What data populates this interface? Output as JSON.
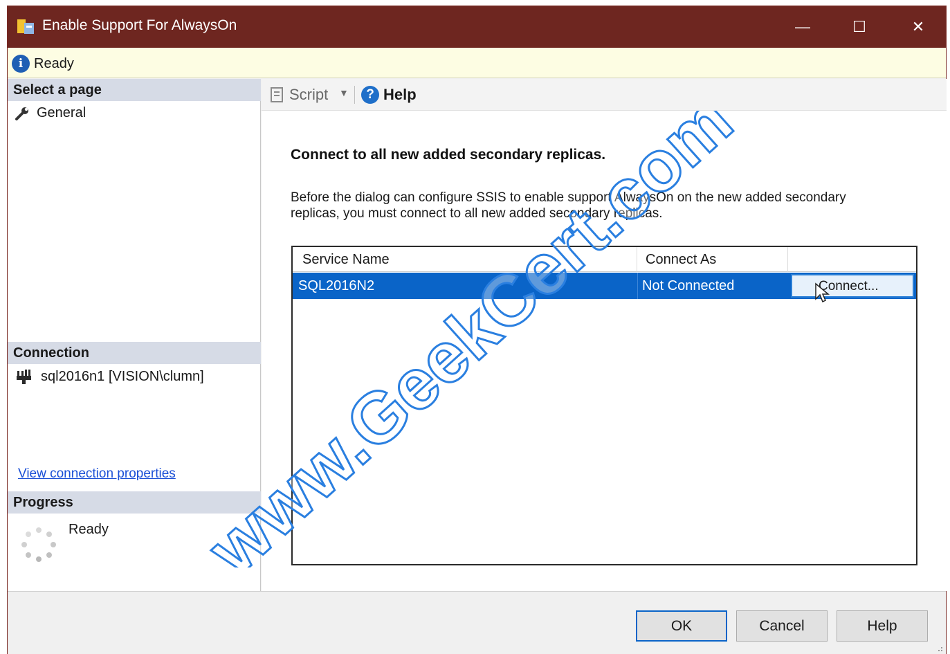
{
  "window": {
    "title": "Enable Support For AlwaysOn",
    "app_icon": "ssms-app-icon",
    "controls": {
      "minimize": "—",
      "maximize": "☐",
      "close": "✕"
    }
  },
  "status_bar": {
    "icon": "info-icon",
    "text": "Ready"
  },
  "left_pane": {
    "select_page_header": "Select a page",
    "pages": [
      {
        "icon": "wrench-icon",
        "label": "General"
      }
    ],
    "connection_header": "Connection",
    "connection_text": "sql2016n1 [VISION\\clumn]",
    "connection_link": "View connection properties",
    "progress_header": "Progress",
    "progress_text": "Ready"
  },
  "toolbar": {
    "script_label": "Script",
    "help_label": "Help"
  },
  "content": {
    "heading": "Connect to all new added secondary replicas.",
    "description": "Before the dialog can configure SSIS to enable support AlwaysOn on the new added secondary replicas, you must connect to all new added secondary replicas.",
    "table": {
      "columns": [
        "Service Name",
        "Connect As",
        ""
      ],
      "rows": [
        {
          "service_name": "SQL2016N2",
          "connect_as": "Not Connected",
          "action": "Connect..."
        }
      ]
    }
  },
  "footer": {
    "ok": "OK",
    "cancel": "Cancel",
    "help": "Help"
  },
  "watermark": {
    "text": "www.GeekCert.com"
  },
  "colors": {
    "titlebar": "#6e2620",
    "selection": "#0a64c8",
    "status_bar": "#fdfde3",
    "section_header": "#d6dbe6",
    "watermark_fill": "#ffffff",
    "watermark_stroke": "#2a7fe0"
  }
}
